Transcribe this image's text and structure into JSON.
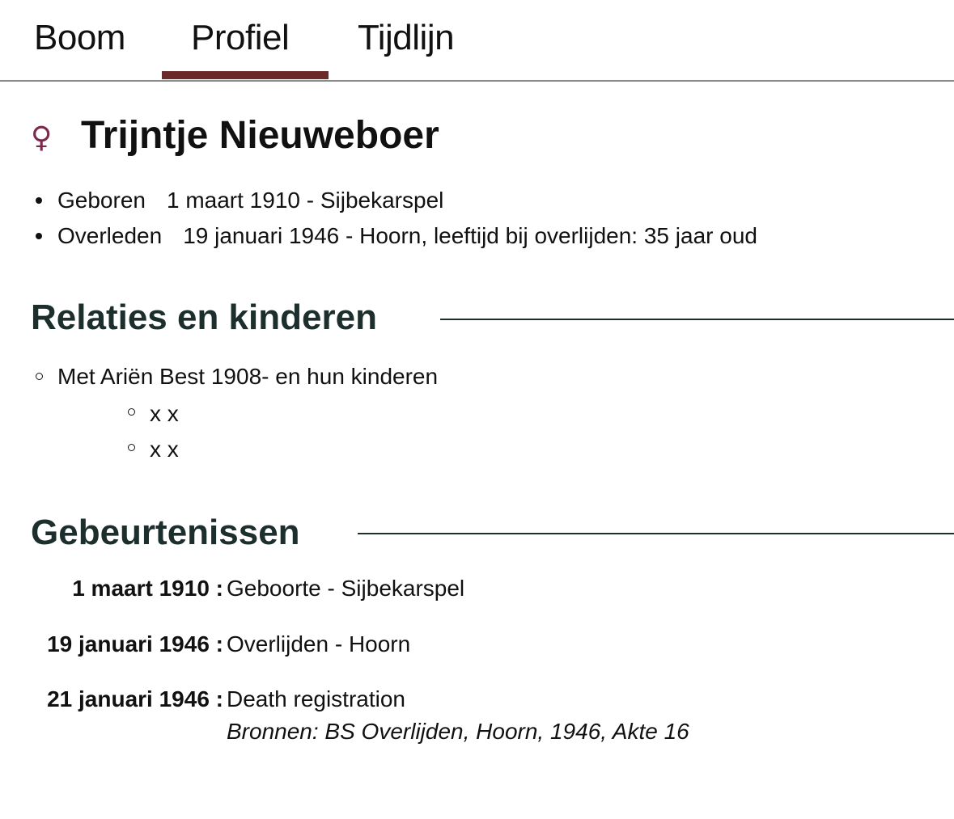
{
  "tabs": [
    {
      "label": "Boom"
    },
    {
      "label": "Profiel",
      "active": true
    },
    {
      "label": "Tijdlijn"
    }
  ],
  "person": {
    "gender_icon": "female-icon",
    "gender_symbol": "♀",
    "name": "Trijntje Nieuweboer",
    "facts": [
      {
        "label": "Geboren",
        "value": "1 maart 1910 - Sijbekarspel"
      },
      {
        "label": "Overleden",
        "value": "19 januari 1946 - Hoorn, leeftijd bij overlijden: 35 jaar oud"
      }
    ]
  },
  "relations": {
    "heading": "Relaties en kinderen",
    "items": [
      {
        "text": "Met Ariën Best 1908- en hun kinderen",
        "children": [
          "x x",
          "x x"
        ]
      }
    ]
  },
  "events": {
    "heading": "Gebeurtenissen",
    "items": [
      {
        "date": "1 maart 1910 :",
        "text": "Geboorte - Sijbekarspel"
      },
      {
        "date": "19 januari 1946 :",
        "text": "Overlijden - Hoorn"
      },
      {
        "date": "21 januari 1946 :",
        "text": "Death registration",
        "source": "Bronnen: BS Overlijden, Hoorn, 1946, Akte 16"
      }
    ]
  },
  "colors": {
    "accent_underline": "#6b2a2a",
    "heading": "#1c2f2c",
    "gender_icon": "#7a2a4a"
  }
}
